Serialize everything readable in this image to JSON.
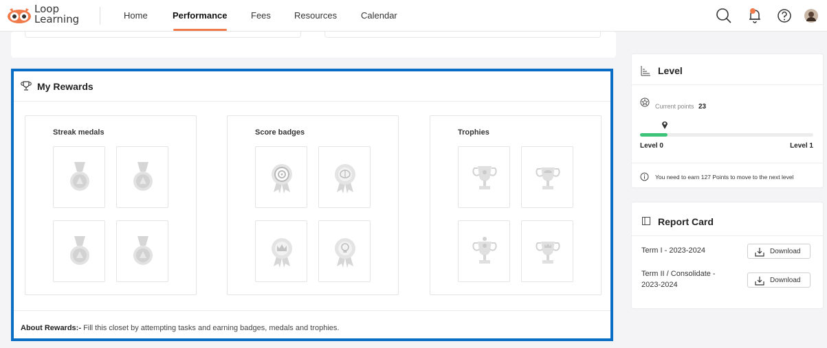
{
  "app": {
    "logo_line1": "Loop",
    "logo_line2": "Learning"
  },
  "nav": {
    "items": [
      "Home",
      "Performance",
      "Fees",
      "Resources",
      "Calendar"
    ],
    "active": "Performance"
  },
  "rewards": {
    "title": "My Rewards",
    "groups": [
      {
        "title": "Streak medals"
      },
      {
        "title": "Score badges"
      },
      {
        "title": "Trophies"
      }
    ],
    "about_label": "About Rewards:-",
    "about_text": "Fill this closet by attempting tasks and earning badges, medals and trophies."
  },
  "level": {
    "title": "Level",
    "current_points_label": "Current points",
    "current_points": "23",
    "level_from": "Level 0",
    "level_to": "Level 1",
    "progress": 0.16,
    "info": "You need to earn 127 Points to move to the next level"
  },
  "report_card": {
    "title": "Report Card",
    "rows": [
      {
        "term": "Term I - 2023-2024",
        "button": "Download"
      },
      {
        "term_line1": "Term II / Consolidate -",
        "term_line2": "2023-2024",
        "button": "Download"
      }
    ]
  },
  "colors": {
    "accent": "#f07a4a",
    "highlight_border": "#0a6fc4",
    "progress": "#3ec47a"
  }
}
